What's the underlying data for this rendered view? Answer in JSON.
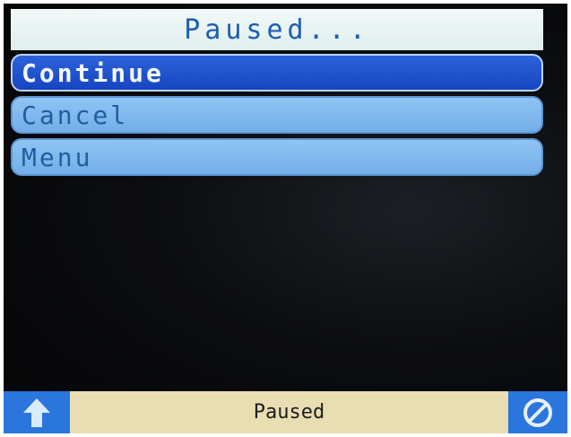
{
  "title": "Paused...",
  "menu": {
    "items": [
      {
        "label": "Continue",
        "selected": true
      },
      {
        "label": "Cancel",
        "selected": false
      },
      {
        "label": "Menu",
        "selected": false
      }
    ]
  },
  "status_bar": {
    "text": "Paused",
    "left_icon": "up-arrow-icon",
    "right_icon": "no-entry-icon"
  },
  "colors": {
    "title_text": "#1b5fb0",
    "selected_item": "#1745c2",
    "normal_item": "#74aee8",
    "status_background": "#e9ddb2",
    "icon_background": "#2b76dc"
  }
}
